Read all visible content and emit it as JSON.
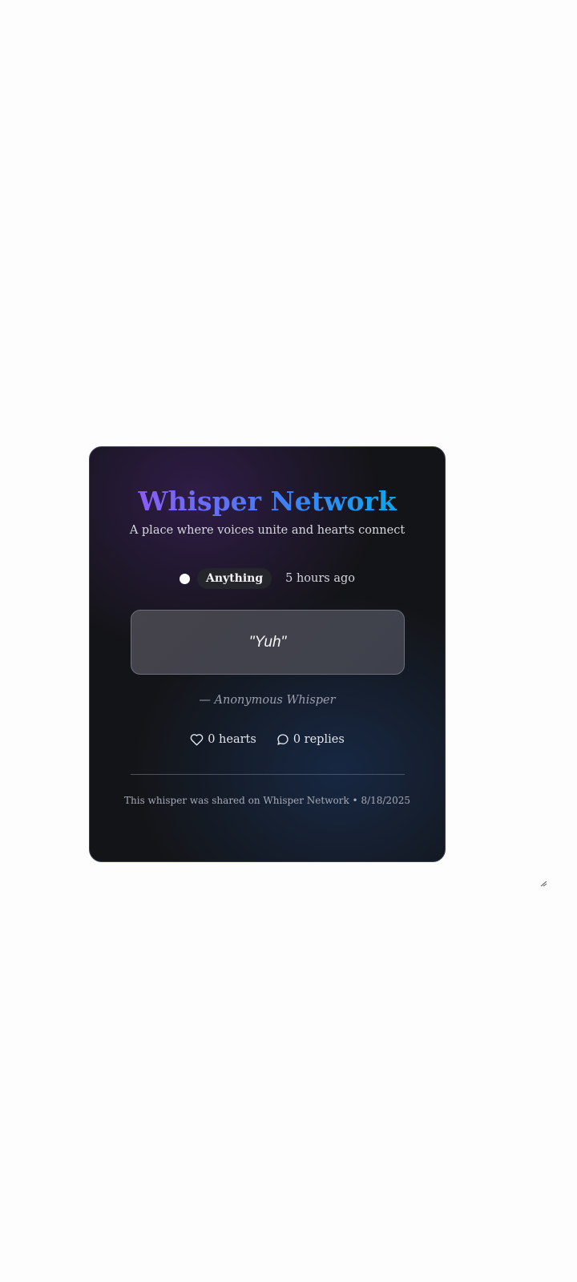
{
  "card": {
    "title": "Whisper Network",
    "subtitle": "A place where voices unite and hearts connect",
    "category": "Anything",
    "time_ago": "5 hours ago",
    "quote": "\"Yuh\"",
    "author": "— Anonymous Whisper",
    "hearts_label": "0 hearts",
    "replies_label": "0 replies",
    "footer": "This whisper was shared on Whisper Network • 8/18/2025"
  },
  "icons": {
    "status": "dot-icon",
    "hearts": "heart-icon",
    "replies": "chat-bubble-icon"
  },
  "colors": {
    "title_gradient_start": "#8b5cf6",
    "title_gradient_end": "#0ea5e9",
    "card_background": "#131417"
  }
}
